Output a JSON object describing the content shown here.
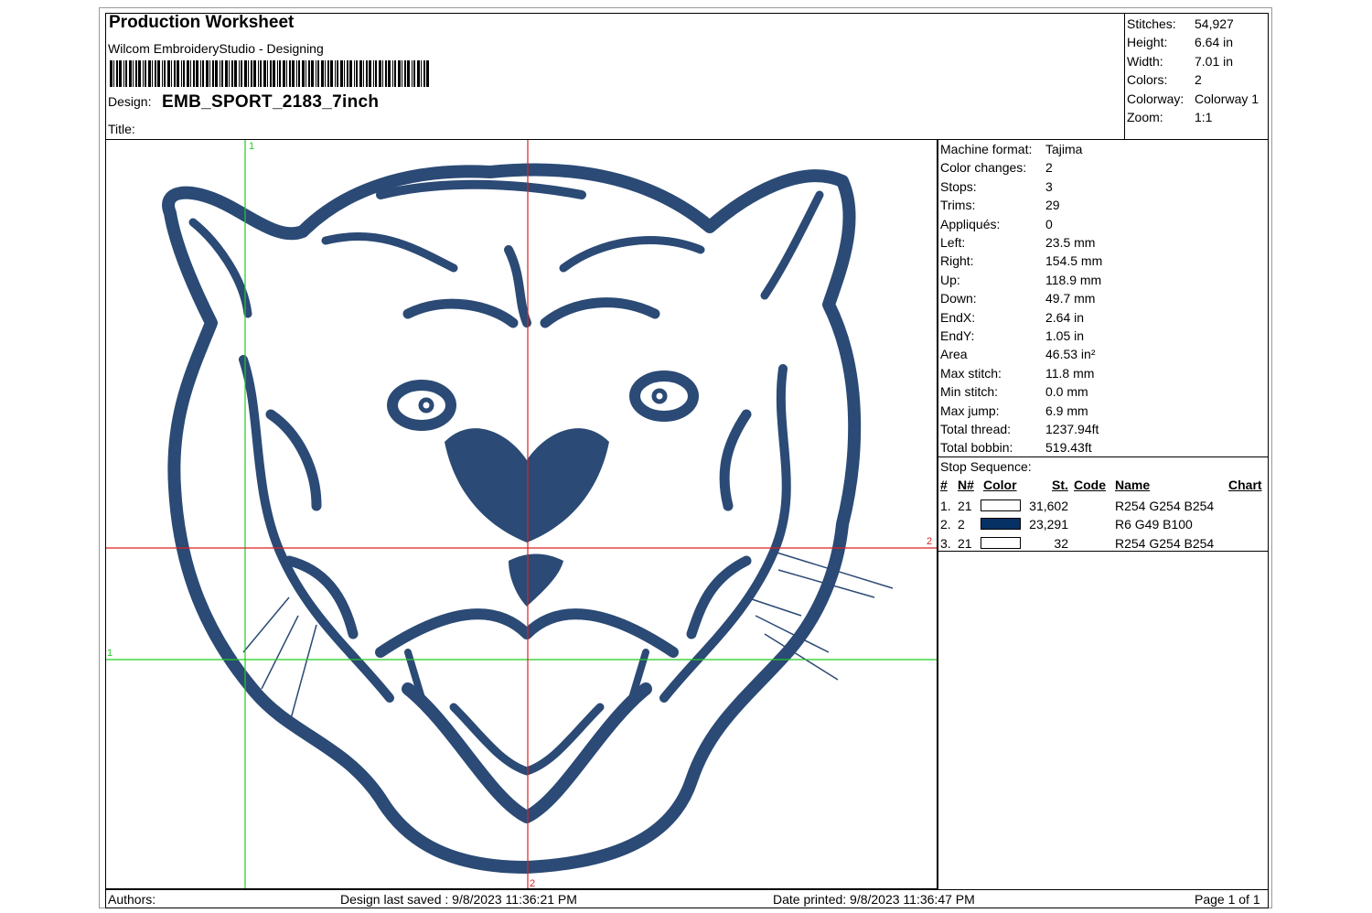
{
  "header": {
    "title": "Production Worksheet",
    "subtitle": "Wilcom EmbroideryStudio - Designing",
    "design_label": "Design:",
    "design_name": "EMB_SPORT_2183_7inch",
    "title_label": "Title:"
  },
  "summary": [
    {
      "label": "Stitches:",
      "value": "54,927"
    },
    {
      "label": "Height:",
      "value": "6.64 in"
    },
    {
      "label": "Width:",
      "value": "7.01 in"
    },
    {
      "label": "Colors:",
      "value": "2"
    },
    {
      "label": "Colorway:",
      "value": "Colorway 1"
    },
    {
      "label": "Zoom:",
      "value": "1:1"
    }
  ],
  "machine_info": [
    {
      "label": "Machine format:",
      "value": "Tajima"
    },
    {
      "label": "Color changes:",
      "value": "2"
    },
    {
      "label": "Stops:",
      "value": "3"
    },
    {
      "label": "Trims:",
      "value": "29"
    },
    {
      "label": "Appliqués:",
      "value": "0"
    },
    {
      "label": "Left:",
      "value": "23.5 mm"
    },
    {
      "label": "Right:",
      "value": "154.5 mm"
    },
    {
      "label": "Up:",
      "value": "118.9 mm"
    },
    {
      "label": "Down:",
      "value": "49.7 mm"
    },
    {
      "label": "EndX:",
      "value": "2.64 in"
    },
    {
      "label": "EndY:",
      "value": "1.05 in"
    },
    {
      "label": "Area",
      "value": "46.53 in²"
    },
    {
      "label": "Max stitch:",
      "value": "11.8 mm"
    },
    {
      "label": "Min stitch:",
      "value": "0.0 mm"
    },
    {
      "label": "Max jump:",
      "value": "6.9 mm"
    },
    {
      "label": "Total thread:",
      "value": "1237.94ft"
    },
    {
      "label": "Total bobbin:",
      "value": "519.43ft"
    }
  ],
  "stop_sequence": {
    "label": "Stop Sequence:",
    "columns": {
      "num": "#",
      "needle": "N#",
      "color": "Color",
      "stitches": "St.",
      "code": "Code",
      "name": "Name",
      "chart": "Chart"
    },
    "rows": [
      {
        "num": "1.",
        "needle": "21",
        "color": "#fefefe",
        "stitches": "31,602",
        "name": "R254 G254 B254"
      },
      {
        "num": "2.",
        "needle": "2",
        "color": "#063164",
        "stitches": "23,291",
        "name": "R6 G49 B100"
      },
      {
        "num": "3.",
        "needle": "21",
        "color": "#fefefe",
        "stitches": "32",
        "name": "R254 G254 B254"
      }
    ]
  },
  "canvas": {
    "marker_1_top": "1",
    "marker_1_left": "1",
    "marker_2_right": "2",
    "marker_2_bottom": "2",
    "thread_color": "#2b4a75",
    "guide_green": "#22cc22",
    "guide_red": "#dd2222"
  },
  "footer": {
    "authors": "Authors:",
    "saved": "Design last saved : 9/8/2023 11:36:21 PM",
    "printed": "Date printed: 9/8/2023 11:36:47 PM",
    "page": "Page 1 of 1"
  }
}
